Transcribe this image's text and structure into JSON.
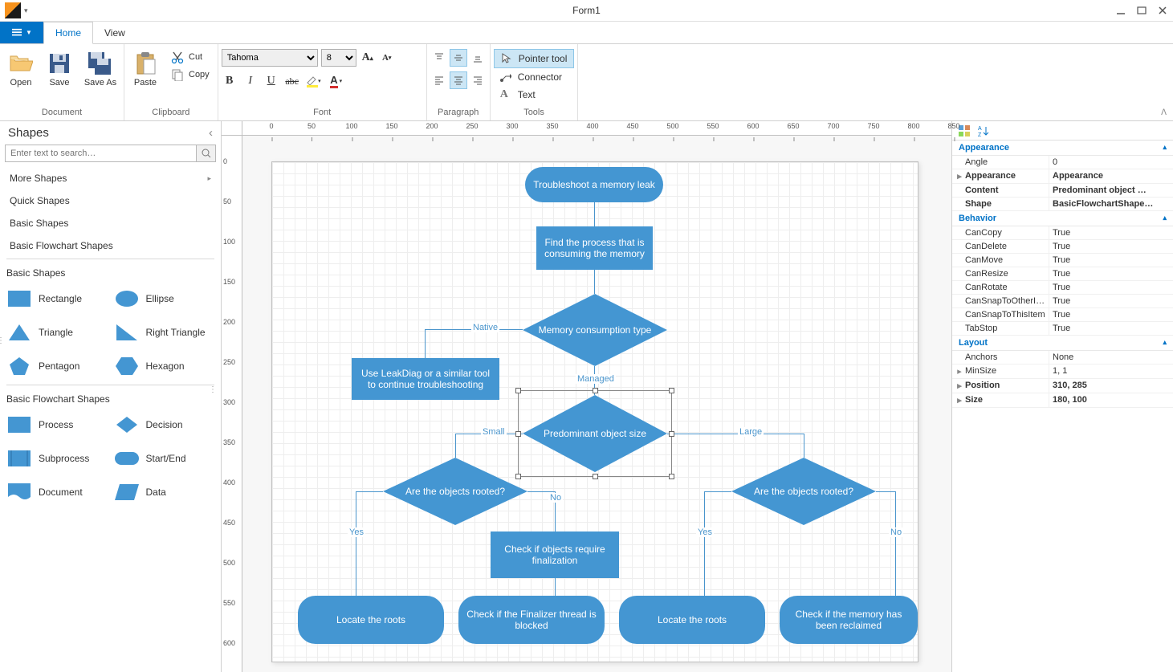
{
  "window": {
    "title": "Form1"
  },
  "tabs": {
    "file_dd": "▾",
    "home": "Home",
    "view": "View"
  },
  "ribbon": {
    "document": {
      "label": "Document",
      "open": "Open",
      "save": "Save",
      "saveas": "Save As"
    },
    "clipboard": {
      "label": "Clipboard",
      "paste": "Paste",
      "cut": "Cut",
      "copy": "Copy"
    },
    "font": {
      "label": "Font",
      "family": "Tahoma",
      "size": "8"
    },
    "paragraph": {
      "label": "Paragraph"
    },
    "tools": {
      "label": "Tools",
      "pointer": "Pointer tool",
      "connector": "Connector",
      "text": "Text"
    }
  },
  "shapes": {
    "title": "Shapes",
    "search_placeholder": "Enter text to search…",
    "cats": [
      "More Shapes",
      "Quick Shapes",
      "Basic Shapes",
      "Basic Flowchart Shapes"
    ],
    "basic_title": "Basic Shapes",
    "basic": [
      "Rectangle",
      "Ellipse",
      "Triangle",
      "Right Triangle",
      "Pentagon",
      "Hexagon"
    ],
    "flow_title": "Basic Flowchart Shapes",
    "flow": [
      "Process",
      "Decision",
      "Subprocess",
      "Start/End",
      "Document",
      "Data"
    ]
  },
  "ruler_h": [
    "0",
    "50",
    "100",
    "150",
    "200",
    "250",
    "300",
    "350",
    "400",
    "450",
    "500",
    "550",
    "600",
    "650",
    "700",
    "750",
    "800",
    "850"
  ],
  "ruler_v": [
    "0",
    "50",
    "100",
    "150",
    "200",
    "250",
    "300",
    "350",
    "400",
    "450",
    "500",
    "550",
    "600"
  ],
  "diagram": {
    "n1": "Troubleshoot a memory leak",
    "n2": "Find the process that is consuming the memory",
    "n3": "Memory consumption type",
    "n4": "Use LeakDiag or a similar tool to continue troubleshooting",
    "n5": "Predominant object size",
    "n6": "Are the objects rooted?",
    "n7": "Are the objects rooted?",
    "n8": "Check if objects require finalization",
    "n9": "Locate the roots",
    "n10": "Check if the Finalizer thread is blocked",
    "n11": "Locate the roots",
    "n12": "Check if the memory has been reclaimed",
    "l_native": "Native",
    "l_managed": "Managed",
    "l_small": "Small",
    "l_large": "Large",
    "l_yes1": "Yes",
    "l_no1": "No",
    "l_yes2": "Yes",
    "l_no2": "No"
  },
  "props": {
    "appearance": {
      "label": "Appearance",
      "angle": {
        "name": "Angle",
        "val": "0"
      },
      "appearance": {
        "name": "Appearance",
        "val": "Appearance"
      },
      "content": {
        "name": "Content",
        "val": "Predominant object …"
      },
      "shape": {
        "name": "Shape",
        "val": "BasicFlowchartShape…"
      }
    },
    "behavior": {
      "label": "Behavior",
      "cancopy": {
        "name": "CanCopy",
        "val": "True"
      },
      "candelete": {
        "name": "CanDelete",
        "val": "True"
      },
      "canmove": {
        "name": "CanMove",
        "val": "True"
      },
      "canresize": {
        "name": "CanResize",
        "val": "True"
      },
      "canrotate": {
        "name": "CanRotate",
        "val": "True"
      },
      "cansnapother": {
        "name": "CanSnapToOtherItems",
        "val": "True"
      },
      "cansnapthis": {
        "name": "CanSnapToThisItem",
        "val": "True"
      },
      "tabstop": {
        "name": "TabStop",
        "val": "True"
      }
    },
    "layout": {
      "label": "Layout",
      "anchors": {
        "name": "Anchors",
        "val": "None"
      },
      "minsize": {
        "name": "MinSize",
        "val": "1, 1"
      },
      "position": {
        "name": "Position",
        "val": "310, 285"
      },
      "size": {
        "name": "Size",
        "val": "180, 100"
      }
    }
  }
}
